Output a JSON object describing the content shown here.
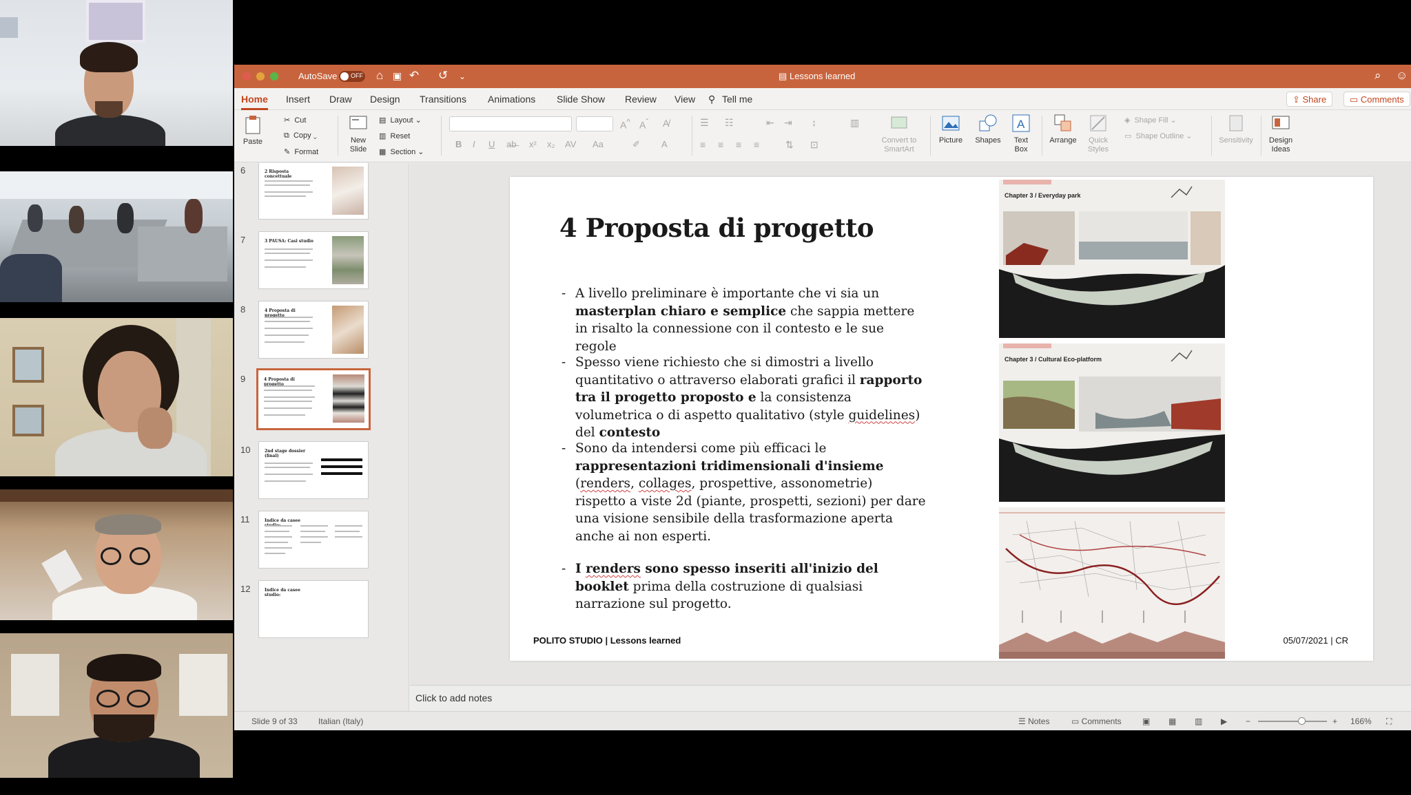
{
  "window": {
    "title": "Lessons learned",
    "autosave_label": "AutoSave",
    "autosave_state": "OFF"
  },
  "tabs": [
    "Home",
    "Insert",
    "Draw",
    "Design",
    "Transitions",
    "Animations",
    "Slide Show",
    "Review",
    "View"
  ],
  "tell_me": "Tell me",
  "share_label": "Share",
  "comments_label": "Comments",
  "ribbon": {
    "paste": "Paste",
    "cut": "Cut",
    "copy": "Copy",
    "format": "Format",
    "new_slide": "New\nSlide",
    "layout": "Layout",
    "reset": "Reset",
    "section": "Section",
    "convert_smartart": "Convert to\nSmartArt",
    "picture": "Picture",
    "shapes": "Shapes",
    "text_box": "Text\nBox",
    "arrange": "Arrange",
    "quick_styles": "Quick\nStyles",
    "shape_fill": "Shape Fill",
    "shape_outline": "Shape Outline",
    "sensitivity": "Sensitivity",
    "design_ideas": "Design\nIdeas"
  },
  "thumbnails": [
    {
      "num": "6",
      "title": "2 Risposta concettuale"
    },
    {
      "num": "7",
      "title": "3 PAUSA: Casi studio"
    },
    {
      "num": "8",
      "title": "4 Proposta di progetto"
    },
    {
      "num": "9",
      "title": "4 Proposta di progetto",
      "selected": true
    },
    {
      "num": "10",
      "title": "2nd stage dossier (final)"
    },
    {
      "num": "11",
      "title": "Indice da casee studio:"
    },
    {
      "num": "12",
      "title": "Indice da casee studio:"
    }
  ],
  "slide": {
    "title": "4 Proposta di progetto",
    "b1_a": "A livello preliminare è importante che vi sia un ",
    "b1_b": "masterplan chiaro e semplice",
    "b1_c": " che sappia mettere in risalto la connessione con il contesto e le sue regole",
    "b2_a": "Spesso viene richiesto che si dimostri a livello quantitativo o attraverso elaborati grafici il ",
    "b2_b": "rapporto tra il progetto proposto e",
    "b2_c": " la consistenza volumetrica o di aspetto qualitativo (style ",
    "b2_d": "guidelines",
    "b2_e": ") del ",
    "b2_f": "contesto",
    "b3_a": "Sono da intendersi come più efficaci le ",
    "b3_b": "rappresentazioni tridimensionali d'insieme",
    "b3_c": " (",
    "b3_d": "renders",
    "b3_e": ", ",
    "b3_f": "collages",
    "b3_g": ", prospettive, assonometrie) rispetto a viste 2d (piante, prospetti, sezioni) per dare una visione sensibile della trasformazione aperta anche ai non esperti.",
    "b4_a": "I ",
    "b4_b": "renders",
    "b4_c": " sono spesso inseriti all'inizio del booklet",
    "b4_d": " prima della costruzione di qualsiasi narrazione sul progetto.",
    "footer_left": "POLITO STUDIO | Lessons learned",
    "footer_right": "05/07/2021 | CR",
    "panel1": "Chapter 3 / Everyday park",
    "panel2": "Chapter 3 / Cultural Eco-platform"
  },
  "notes_placeholder": "Click to add notes",
  "status": {
    "slide": "Slide 9 of 33",
    "language": "Italian (Italy)",
    "notes": "Notes",
    "comments": "Comments",
    "zoom": "166%"
  }
}
